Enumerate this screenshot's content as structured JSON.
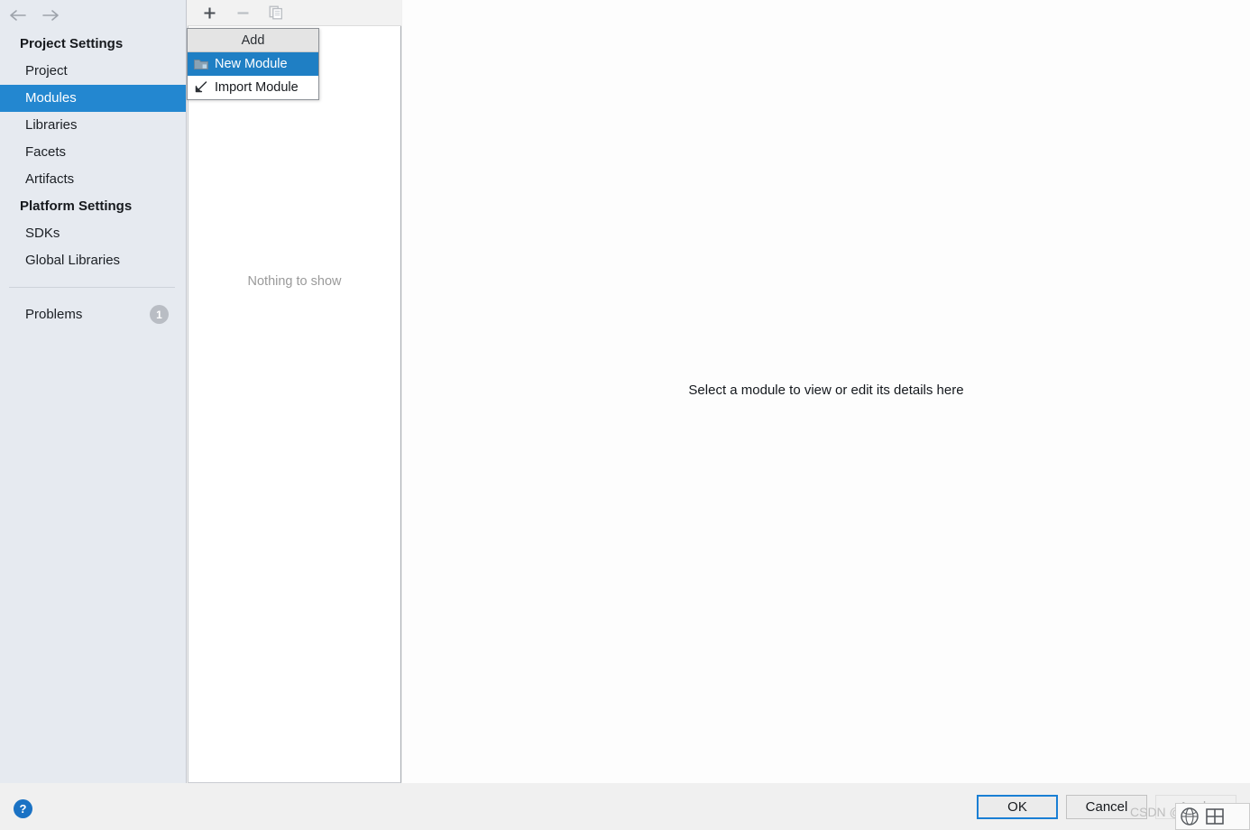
{
  "sidebar": {
    "nav": {
      "back_icon": "arrow-left-icon",
      "forward_icon": "arrow-right-icon"
    },
    "project_settings_header": "Project Settings",
    "project_items": [
      {
        "label": "Project",
        "selected": false
      },
      {
        "label": "Modules",
        "selected": true
      },
      {
        "label": "Libraries",
        "selected": false
      },
      {
        "label": "Facets",
        "selected": false
      },
      {
        "label": "Artifacts",
        "selected": false
      }
    ],
    "platform_settings_header": "Platform Settings",
    "platform_items": [
      {
        "label": "SDKs",
        "selected": false
      },
      {
        "label": "Global Libraries",
        "selected": false
      }
    ],
    "problems": {
      "label": "Problems",
      "count": "1"
    },
    "selection_color": "#2387d0",
    "background_color": "#e6eaf0"
  },
  "modules_panel": {
    "toolbar": [
      {
        "name": "add-button",
        "icon": "plus-icon",
        "enabled": true
      },
      {
        "name": "remove-button",
        "icon": "minus-icon",
        "enabled": false
      },
      {
        "name": "copy-button",
        "icon": "copy-icon",
        "enabled": false
      }
    ],
    "empty_text": "Nothing to show"
  },
  "add_menu": {
    "title": "Add",
    "items": [
      {
        "label": "New Module",
        "icon": "folder-icon",
        "highlighted": true
      },
      {
        "label": "Import Module",
        "icon": "import-arrow-icon",
        "highlighted": false
      }
    ],
    "highlight_color": "#1f7fc4"
  },
  "detail_panel": {
    "placeholder_text": "Select a module to view or edit its details here"
  },
  "footer": {
    "help_label": "?",
    "ok_label": "OK",
    "cancel_label": "Cancel",
    "apply_label": "Apply",
    "ok_focus_color": "#1a7fd4"
  },
  "watermark": {
    "text": "CSDN @li___2007"
  }
}
